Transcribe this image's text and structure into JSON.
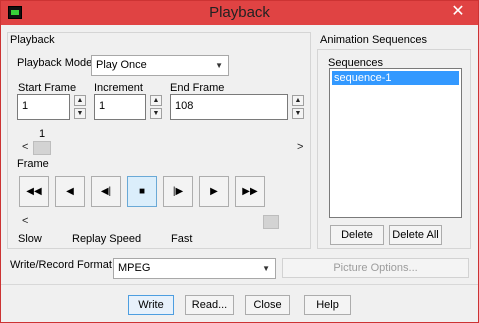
{
  "window": {
    "title": "Playback",
    "close_glyph": "✕"
  },
  "playback": {
    "group_label": "Playback",
    "mode_label": "Playback Mode",
    "mode_value": "Play Once",
    "start_label": "Start Frame",
    "start_value": "1",
    "increment_label": "Increment",
    "increment_value": "1",
    "end_label": "End Frame",
    "end_value": "108",
    "frame_slider_value": "1",
    "frame_label": "Frame",
    "speed_slow": "Slow",
    "speed_label": "Replay Speed",
    "speed_fast": "Fast",
    "speed_level": 0.95,
    "controls": [
      {
        "name": "rewind-to-start-icon",
        "glyph": "◀◀"
      },
      {
        "name": "play-backward-icon",
        "glyph": "◀"
      },
      {
        "name": "step-backward-icon",
        "glyph": "◀|"
      },
      {
        "name": "stop-icon",
        "glyph": "■"
      },
      {
        "name": "step-forward-icon",
        "glyph": "|▶"
      },
      {
        "name": "play-forward-icon",
        "glyph": "▶"
      },
      {
        "name": "fast-forward-to-end-icon",
        "glyph": "▶▶"
      }
    ]
  },
  "animation": {
    "group_label": "Animation Sequences",
    "sequences_label": "Sequences",
    "items": [
      "sequence-1"
    ],
    "delete_label": "Delete",
    "delete_all_label": "Delete All"
  },
  "record": {
    "format_label": "Write/Record Format",
    "format_value": "MPEG",
    "picture_options_label": "Picture Options..."
  },
  "footer": {
    "write_label": "Write",
    "read_label": "Read...",
    "close_label": "Close",
    "help_label": "Help"
  }
}
